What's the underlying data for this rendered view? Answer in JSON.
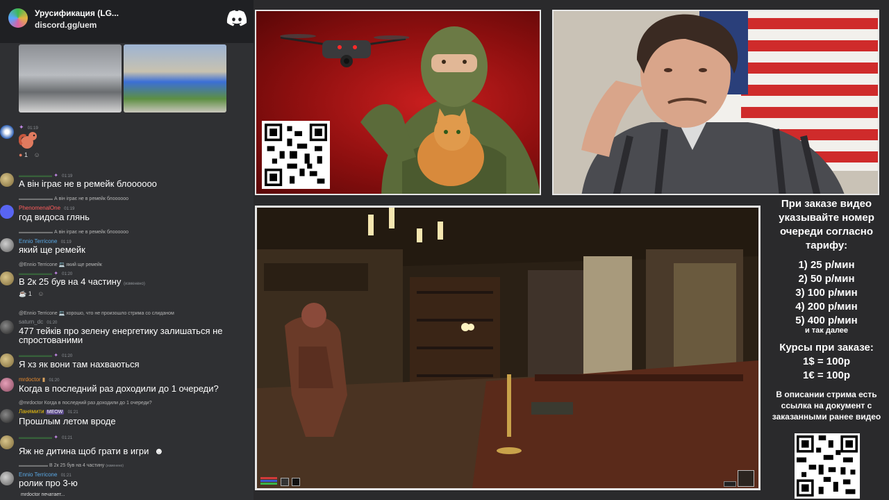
{
  "chat": {
    "server_name": "Урусификация (LG...",
    "invite": "discord.gg/uem",
    "messages": [
      {
        "time": "01:19",
        "reaction_count": "1"
      },
      {
        "time": "01:19",
        "text": "А він іграє не в ремейк блоооооо"
      },
      {
        "reply": "А він іграє не в ремейк блоооооо",
        "user": "PhenomenalOne",
        "time": "01:19",
        "text": "год видоса глянь"
      },
      {
        "reply": "А він іграє не в ремейк блоооооо",
        "user": "Ennio Terricone",
        "time": "01:19",
        "text": "який ще ремейк"
      },
      {
        "reply": "@Ennio Terricone 💻 який ще ремейк",
        "time": "01:20",
        "text": "В 2к 25 був на 4 частину",
        "edited": "(изменено)",
        "reaction_count": "1"
      },
      {
        "reply": "@Ennio Terricone 💻 хорошо, что не произошло стрима со слиданом",
        "user": "saturn_dc",
        "time": "01:20",
        "text": "477 тейків про зелену енергетику залишаться не спростованими"
      },
      {
        "time": "01:20",
        "text": "Я хз як вони там нахваються"
      },
      {
        "user": "mrdoctor",
        "time": "01:20",
        "text": "Когда в последний раз доходили до 1 очереди?"
      },
      {
        "reply": "@mrdoctor Когда в последний раз доходили до 1 очереди?",
        "user": "Ланямити",
        "badge": "MEOW",
        "time": "01:21",
        "text": "Прошлым летом вроде"
      },
      {
        "time": "01:21",
        "text": "Яж не дитина щоб грати в игри"
      },
      {
        "reply": "В 2к 25 був на 4 частину",
        "reply_edited": "(изменено)",
        "user": "Ennio Terricone",
        "time": "01:21",
        "text": "ролик про 3-ю"
      }
    ],
    "typing": "mrdoctor печатает..."
  },
  "info": {
    "heading": "При заказе видео указывайте номер очереди согласно тарифу:",
    "tariffs": [
      "1) 25 р/мин",
      "2) 50 р/мин",
      "3) 100 р/мин",
      "4) 200 р/мин",
      "5) 400 р/мин"
    ],
    "tariffs_more": "и так далее",
    "rates_heading": "Курсы при заказе:",
    "rate_usd": "1$ = 100р",
    "rate_eur": "1€ = 100р",
    "description": "В описании стрима есть ссылка на документ с заказанными ранее видео"
  },
  "colors": {
    "panel_bg": "#2f3033",
    "header_bg": "#1f2023",
    "poster_red": "#c81e1e",
    "discord_blurple": "#5865f2"
  }
}
